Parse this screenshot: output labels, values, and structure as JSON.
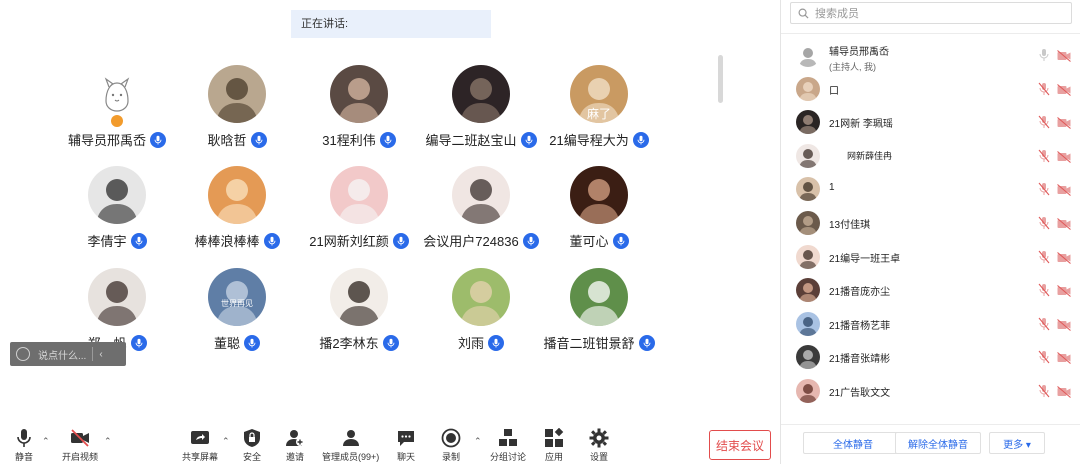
{
  "speaking": {
    "label": "正在讲话:"
  },
  "gallery": [
    {
      "name": "辅导员邢禹岙",
      "bg": "#ffffff",
      "fg": "#666",
      "kind": "cat-sketch",
      "host": true
    },
    {
      "name": "耿晗哲",
      "bg": "#b9a78f",
      "fg": "#4a3b2a",
      "kind": "photo"
    },
    {
      "name": "31程利伟",
      "bg": "#5a4a43",
      "fg": "#d9b9a3",
      "kind": "photo"
    },
    {
      "name": "编导二班赵宝山",
      "bg": "#2d2426",
      "fg": "#8e7a6c",
      "kind": "photo"
    },
    {
      "name": "21编导程大为",
      "bg": "#c99a62",
      "fg": "#f3e3cc",
      "kind": "dog",
      "overlay": "麻了"
    },
    {
      "name": "李倩宇",
      "bg": "#e6e6e6",
      "fg": "#2b2b2b",
      "kind": "photo"
    },
    {
      "name": "棒棒浪棒棒",
      "bg": "#e49a55",
      "fg": "#fbe3c0",
      "kind": "photo"
    },
    {
      "name": "21网新刘红颜",
      "bg": "#f2c9c9",
      "fg": "#f5f5f5",
      "kind": "photo"
    },
    {
      "name": "会议用户724836",
      "bg": "#f0e6e3",
      "fg": "#3a2f2c",
      "kind": "photo"
    },
    {
      "name": "董可心",
      "bg": "#3b1e14",
      "fg": "#d9a485",
      "kind": "photo"
    },
    {
      "name": "郑一帆",
      "bg": "#e7e2de",
      "fg": "#3b2d2a",
      "kind": "photo"
    },
    {
      "name": "董聪",
      "bg": "#5f7ea6",
      "fg": "#c9d7e6",
      "kind": "photo",
      "overlay": "世界再见"
    },
    {
      "name": "播2李林东",
      "bg": "#f2ede8",
      "fg": "#2b211c",
      "kind": "photo"
    },
    {
      "name": "刘雨",
      "bg": "#9dbc6b",
      "fg": "#e8d3b0",
      "kind": "photo"
    },
    {
      "name": "播音二班钳景舒",
      "bg": "#5f8f4a",
      "fg": "#ffffff",
      "kind": "photo"
    }
  ],
  "chat_input": {
    "placeholder": "说点什么..."
  },
  "toolbar": {
    "mute": "静音",
    "video": "开启视频",
    "share": "共享屏幕",
    "security": "安全",
    "invite": "邀请",
    "members": "管理成员(99+)",
    "chat": "聊天",
    "record": "录制",
    "breakout": "分组讨论",
    "apps": "应用",
    "settings": "设置",
    "end_meeting": "结束会议"
  },
  "panel": {
    "search_placeholder": "搜索成员",
    "members": [
      {
        "name": "辅导员邢禹岙",
        "sub": "(主持人, 我)",
        "bg": "#ffffff",
        "fg": "#888",
        "mic_muted": false
      },
      {
        "name": "口",
        "bg": "#c9a78a",
        "fg": "#f1ddc9",
        "mic_muted": true
      },
      {
        "name": "21网新 李珮瑶",
        "bg": "#2a2524",
        "fg": "#b19b8c",
        "mic_muted": true
      },
      {
        "name": "网新薛佳冉",
        "bg": "#efe7e4",
        "fg": "#3b2d28",
        "mic_muted": true,
        "small": true
      },
      {
        "name": "1",
        "bg": "#d8c1a9",
        "fg": "#3b2d22",
        "mic_muted": true
      },
      {
        "name": "13付佳琪",
        "bg": "#6b5a4b",
        "fg": "#c9b39a",
        "mic_muted": true
      },
      {
        "name": "21编导一班王卓",
        "bg": "#f0d9cf",
        "fg": "#3b2a22",
        "mic_muted": true
      },
      {
        "name": "21播音庞亦尘",
        "bg": "#5b3f38",
        "fg": "#e5b59b",
        "mic_muted": true
      },
      {
        "name": "21播音杨艺菲",
        "bg": "#a9c2e3",
        "fg": "#2b4466",
        "mic_muted": true
      },
      {
        "name": "21播音张靖彬",
        "bg": "#3a3a3a",
        "fg": "#cfcfcf",
        "mic_muted": true
      },
      {
        "name": "21广告耿文文",
        "bg": "#e6b7b0",
        "fg": "#5b2a22",
        "mic_muted": true
      }
    ],
    "mute_all": "全体静音",
    "unmute_all": "解除全体静音",
    "more": "更多 ▾"
  }
}
